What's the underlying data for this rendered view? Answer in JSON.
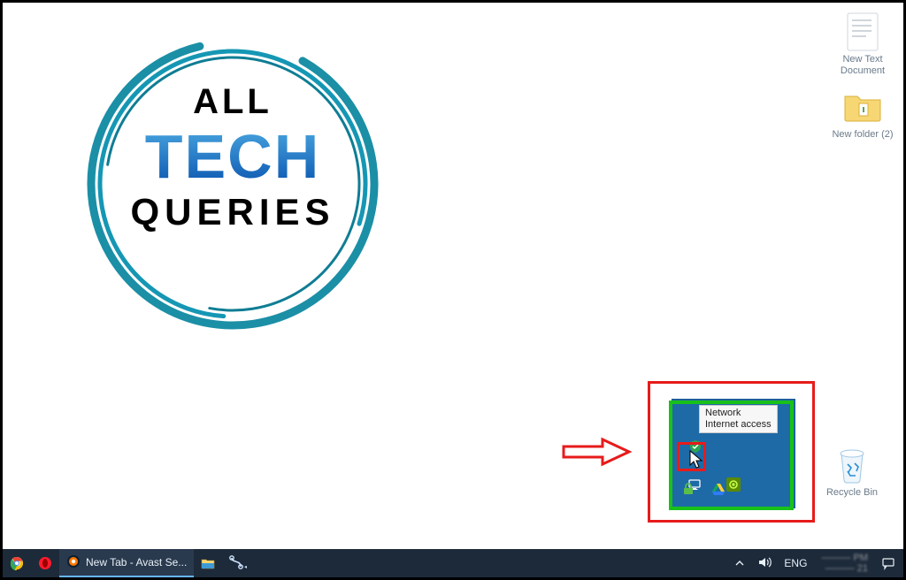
{
  "desktop_icons": [
    {
      "name": "new-text-document",
      "label": "New Text Document"
    },
    {
      "name": "new-folder-2",
      "label": "New folder (2)"
    },
    {
      "name": "recycle-bin",
      "label": "Recycle Bin"
    }
  ],
  "logo": {
    "line1": "ALL",
    "line2": "TECH",
    "line3": "QUERIES"
  },
  "tray_flyout": {
    "tooltip_line1": "Network",
    "tooltip_line2": "Internet access",
    "icons": [
      "windows-defender-icon",
      "network-icon",
      "nvidia-icon",
      "bitlocker-icon",
      "google-drive-icon"
    ]
  },
  "taskbar": {
    "pinned": [
      {
        "name": "chrome-icon"
      },
      {
        "name": "opera-icon"
      }
    ],
    "open_window": {
      "name": "avast-window",
      "title": "New Tab - Avast Se..."
    },
    "extra_pinned": [
      {
        "name": "file-explorer-icon"
      },
      {
        "name": "snipping-tool-icon"
      }
    ],
    "tray": {
      "chevron_name": "show-hidden-icons",
      "volume_name": "volume-icon",
      "language": "ENG"
    },
    "action_center_name": "action-center-icon"
  }
}
